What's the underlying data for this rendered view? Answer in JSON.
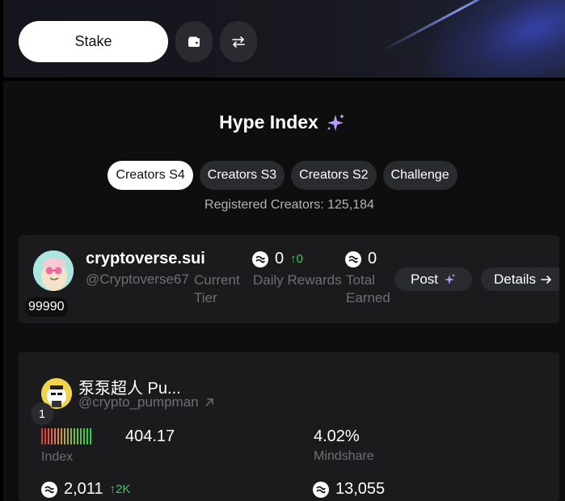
{
  "header": {
    "stake_label": "Stake",
    "wallet_icon": "wallet-icon",
    "swap_icon": "swap-arrows-icon"
  },
  "hype": {
    "title": "Hype Index",
    "sparkle_icon": "sparkles-icon",
    "tabs": [
      {
        "label": "Creators S4",
        "active": true
      },
      {
        "label": "Creators S3",
        "active": false
      },
      {
        "label": "Creators S2",
        "active": false
      },
      {
        "label": "Challenge",
        "active": false
      }
    ],
    "registered": "Registered Creators: 125,184"
  },
  "creator": {
    "name": "cryptoverse.sui",
    "handle": "@Cryptoverse67",
    "rank": "99990",
    "current_tier_label": "Current Tier",
    "daily_rewards_value": "0",
    "daily_rewards_change": "↑0",
    "daily_rewards_label": "Daily Rewards",
    "total_earned_value": "0",
    "total_earned_label": "Total Earned",
    "post_label": "Post",
    "details_label": "Details"
  },
  "leaderboard": {
    "rank": "1",
    "name": "泵泵超人 Pu...",
    "handle": "@crypto_pumpman",
    "index_value": "404.17",
    "index_label": "Index",
    "mindshare_value": "4.02%",
    "mindshare_label": "Mindshare",
    "rewards_value": "2,011",
    "rewards_change": "↑2K",
    "earned_value": "13,055"
  },
  "colors": {
    "accent_green": "#34d058",
    "panel_bg": "#1b1b1d",
    "sparkle_purple": "#b79cff"
  }
}
